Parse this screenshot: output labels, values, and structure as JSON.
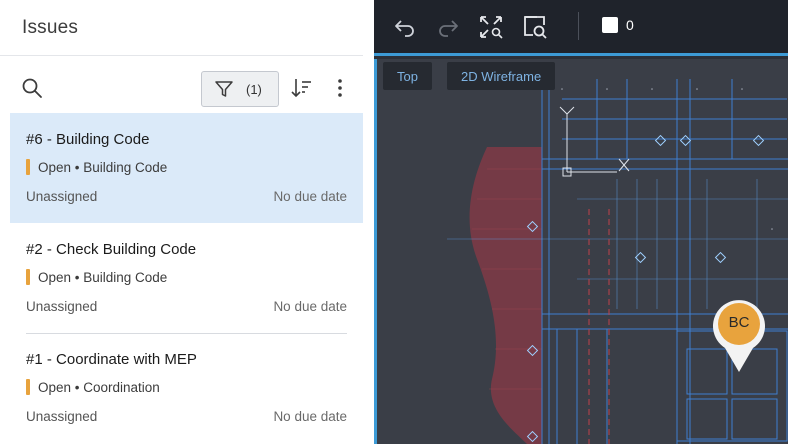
{
  "panel": {
    "title": "Issues",
    "filter_count": "(1)"
  },
  "issues": [
    {
      "title": "#6 - Building Code",
      "status": "Open • Building Code",
      "assignee": "Unassigned",
      "due": "No due date"
    },
    {
      "title": "#2 - Check Building Code",
      "status": "Open • Building Code",
      "assignee": "Unassigned",
      "due": "No due date"
    },
    {
      "title": "#1 - Coordinate with MEP",
      "status": "Open • Coordination",
      "assignee": "Unassigned",
      "due": "No due date"
    }
  ],
  "viewer": {
    "layer_value": "0",
    "view_top": "Top",
    "view_style": "2D Wireframe",
    "pin_label": "BC"
  },
  "colors": {
    "accent": "#3d9bd6",
    "status_open": "#e8a33d",
    "selected_row": "#dbeaf9",
    "pin": "#e8a33d"
  },
  "icons": [
    "search-icon",
    "filter-icon",
    "sort-icon",
    "more-icon",
    "undo-icon",
    "redo-icon",
    "fit-to-view-icon",
    "zoom-window-icon"
  ]
}
